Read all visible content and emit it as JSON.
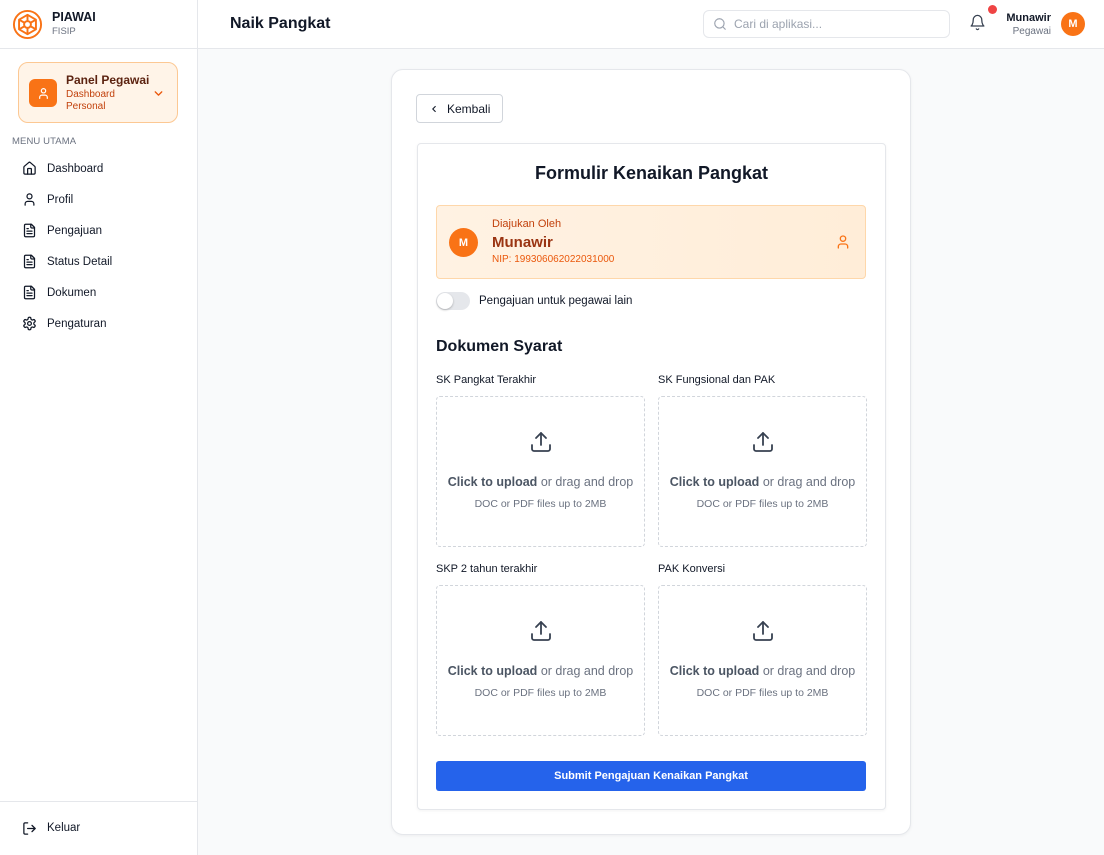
{
  "colors": {
    "accent": "#f97316",
    "primary": "#2563eb",
    "danger": "#ef4444",
    "page_bg": "#f9fafb"
  },
  "brand": {
    "name": "PIAWAI",
    "sub": "FISIP",
    "icon": "logo-icon"
  },
  "panel": {
    "title": "Panel Pegawai",
    "subtitle": "Dashboard Personal",
    "icon": "user-icon"
  },
  "menu": {
    "heading": "MENU UTAMA",
    "items": [
      {
        "label": "Dashboard",
        "icon": "home-icon"
      },
      {
        "label": "Profil",
        "icon": "user-icon"
      },
      {
        "label": "Pengajuan",
        "icon": "document-icon"
      },
      {
        "label": "Status Detail",
        "icon": "document-icon"
      },
      {
        "label": "Dokumen",
        "icon": "document-icon"
      },
      {
        "label": "Pengaturan",
        "icon": "gear-icon"
      }
    ]
  },
  "logout": {
    "label": "Keluar",
    "icon": "logout-icon"
  },
  "header": {
    "title": "Naik Pangkat",
    "search": {
      "placeholder": "Cari di aplikasi...",
      "value": ""
    },
    "notification_dot": true,
    "user": {
      "name": "Munawir",
      "role": "Pegawai",
      "initial": "M"
    }
  },
  "form": {
    "back_label": "Kembali",
    "title": "Formulir Kenaikan Pangkat",
    "submitter": {
      "label": "Diajukan Oleh",
      "name": "Munawir",
      "nip": "NIP: 199306062022031000",
      "initial": "M"
    },
    "toggle": {
      "label": "Pengajuan untuk pegawai lain",
      "checked": false
    },
    "section_title": "Dokumen Syarat",
    "documents": [
      {
        "label": "SK Pangkat Terakhir"
      },
      {
        "label": "SK Fungsional dan PAK"
      },
      {
        "label": "SKP 2 tahun terakhir"
      },
      {
        "label": "PAK Konversi"
      }
    ],
    "upload": {
      "action": "Click to upload",
      "rest": "or drag and drop",
      "hint": "DOC or PDF files up to 2MB"
    },
    "submit_label": "Submit Pengajuan Kenaikan Pangkat"
  }
}
